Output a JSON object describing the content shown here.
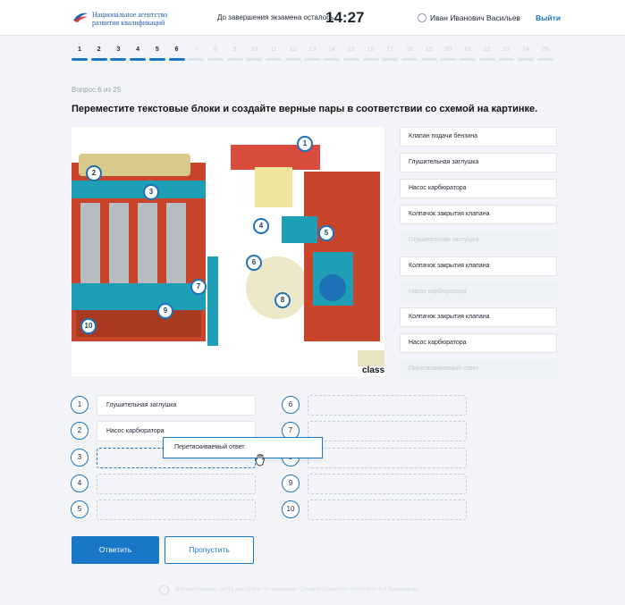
{
  "header": {
    "logo_line1": "Национальное агентство",
    "logo_line2": "развития квалификаций",
    "timer_label": "До завершения экзамена осталось",
    "timer": "14:27",
    "user_name": "Иван Иванович Васильев",
    "logout": "Выйти"
  },
  "steps": {
    "current": 6,
    "labels": [
      "1",
      "2",
      "3",
      "4",
      "5",
      "6",
      "7",
      "8",
      "9",
      "10",
      "11",
      "12",
      "13",
      "14",
      "15",
      "16",
      "17",
      "18",
      "19",
      "20",
      "21",
      "22",
      "23",
      "24",
      "25"
    ]
  },
  "question": {
    "number": "Вопрос 6 из 25",
    "text": "Переместите текстовые блоки и создайте верные пары в соответствии со схемой на картинке."
  },
  "image": {
    "callouts": [
      "1",
      "2",
      "3",
      "4",
      "5",
      "6",
      "7",
      "8",
      "9",
      "10"
    ],
    "watermark": "class"
  },
  "answers": [
    {
      "label": "Клапан подачи бензина",
      "used": false
    },
    {
      "label": "Глушительная заглушка",
      "used": false
    },
    {
      "label": "Насос карбюратора",
      "used": false
    },
    {
      "label": "Колпачок закрытия клапана",
      "used": false
    },
    {
      "label": "Глушительная заглушка",
      "used": true
    },
    {
      "label": "Колпачок закрытия клапана",
      "used": false
    },
    {
      "label": "Насос карбюратора",
      "used": true
    },
    {
      "label": "Колпачок закрытия клапана",
      "used": false
    },
    {
      "label": "Насос карбюратора",
      "used": false
    },
    {
      "label": "Перетаскиваемый ответ",
      "used": true
    }
  ],
  "slots": [
    {
      "num": "1",
      "value": "Глушительная заглушка"
    },
    {
      "num": "2",
      "value": "Насос карбюратора"
    },
    {
      "num": "3",
      "value": ""
    },
    {
      "num": "4",
      "value": ""
    },
    {
      "num": "5",
      "value": ""
    },
    {
      "num": "6",
      "value": ""
    },
    {
      "num": "7",
      "value": ""
    },
    {
      "num": "8",
      "value": ""
    },
    {
      "num": "9",
      "value": ""
    },
    {
      "num": "10",
      "value": ""
    }
  ],
  "dragging": "Перетаскиваемый ответ",
  "buttons": {
    "submit": "Ответить",
    "skip": "Пропустить"
  },
  "footer": "Все материалы сайта доступны по лицензии: Creative Commons Attribution 4.0 Всемирная",
  "colors": {
    "accent": "#1977c8",
    "engine_red": "#c8442a",
    "engine_cyan": "#1e9fb5"
  }
}
